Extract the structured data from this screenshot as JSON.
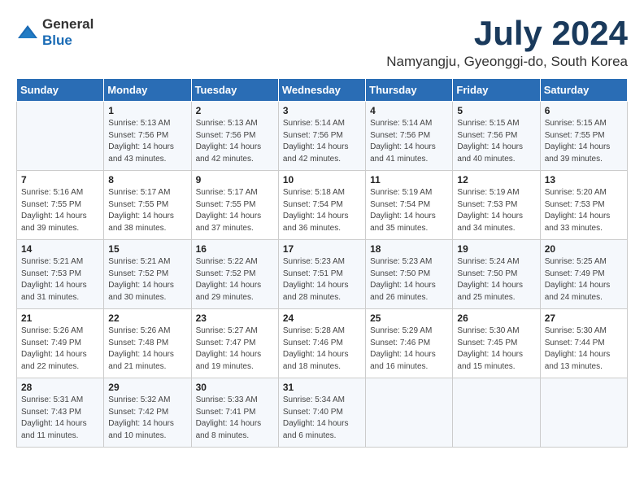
{
  "header": {
    "logo_general": "General",
    "logo_blue": "Blue",
    "month_title": "July 2024",
    "location": "Namyangju, Gyeonggi-do, South Korea"
  },
  "days_of_week": [
    "Sunday",
    "Monday",
    "Tuesday",
    "Wednesday",
    "Thursday",
    "Friday",
    "Saturday"
  ],
  "weeks": [
    [
      {
        "day": "",
        "info": ""
      },
      {
        "day": "1",
        "info": "Sunrise: 5:13 AM\nSunset: 7:56 PM\nDaylight: 14 hours\nand 43 minutes."
      },
      {
        "day": "2",
        "info": "Sunrise: 5:13 AM\nSunset: 7:56 PM\nDaylight: 14 hours\nand 42 minutes."
      },
      {
        "day": "3",
        "info": "Sunrise: 5:14 AM\nSunset: 7:56 PM\nDaylight: 14 hours\nand 42 minutes."
      },
      {
        "day": "4",
        "info": "Sunrise: 5:14 AM\nSunset: 7:56 PM\nDaylight: 14 hours\nand 41 minutes."
      },
      {
        "day": "5",
        "info": "Sunrise: 5:15 AM\nSunset: 7:56 PM\nDaylight: 14 hours\nand 40 minutes."
      },
      {
        "day": "6",
        "info": "Sunrise: 5:15 AM\nSunset: 7:55 PM\nDaylight: 14 hours\nand 39 minutes."
      }
    ],
    [
      {
        "day": "7",
        "info": "Sunrise: 5:16 AM\nSunset: 7:55 PM\nDaylight: 14 hours\nand 39 minutes."
      },
      {
        "day": "8",
        "info": "Sunrise: 5:17 AM\nSunset: 7:55 PM\nDaylight: 14 hours\nand 38 minutes."
      },
      {
        "day": "9",
        "info": "Sunrise: 5:17 AM\nSunset: 7:55 PM\nDaylight: 14 hours\nand 37 minutes."
      },
      {
        "day": "10",
        "info": "Sunrise: 5:18 AM\nSunset: 7:54 PM\nDaylight: 14 hours\nand 36 minutes."
      },
      {
        "day": "11",
        "info": "Sunrise: 5:19 AM\nSunset: 7:54 PM\nDaylight: 14 hours\nand 35 minutes."
      },
      {
        "day": "12",
        "info": "Sunrise: 5:19 AM\nSunset: 7:53 PM\nDaylight: 14 hours\nand 34 minutes."
      },
      {
        "day": "13",
        "info": "Sunrise: 5:20 AM\nSunset: 7:53 PM\nDaylight: 14 hours\nand 33 minutes."
      }
    ],
    [
      {
        "day": "14",
        "info": "Sunrise: 5:21 AM\nSunset: 7:53 PM\nDaylight: 14 hours\nand 31 minutes."
      },
      {
        "day": "15",
        "info": "Sunrise: 5:21 AM\nSunset: 7:52 PM\nDaylight: 14 hours\nand 30 minutes."
      },
      {
        "day": "16",
        "info": "Sunrise: 5:22 AM\nSunset: 7:52 PM\nDaylight: 14 hours\nand 29 minutes."
      },
      {
        "day": "17",
        "info": "Sunrise: 5:23 AM\nSunset: 7:51 PM\nDaylight: 14 hours\nand 28 minutes."
      },
      {
        "day": "18",
        "info": "Sunrise: 5:23 AM\nSunset: 7:50 PM\nDaylight: 14 hours\nand 26 minutes."
      },
      {
        "day": "19",
        "info": "Sunrise: 5:24 AM\nSunset: 7:50 PM\nDaylight: 14 hours\nand 25 minutes."
      },
      {
        "day": "20",
        "info": "Sunrise: 5:25 AM\nSunset: 7:49 PM\nDaylight: 14 hours\nand 24 minutes."
      }
    ],
    [
      {
        "day": "21",
        "info": "Sunrise: 5:26 AM\nSunset: 7:49 PM\nDaylight: 14 hours\nand 22 minutes."
      },
      {
        "day": "22",
        "info": "Sunrise: 5:26 AM\nSunset: 7:48 PM\nDaylight: 14 hours\nand 21 minutes."
      },
      {
        "day": "23",
        "info": "Sunrise: 5:27 AM\nSunset: 7:47 PM\nDaylight: 14 hours\nand 19 minutes."
      },
      {
        "day": "24",
        "info": "Sunrise: 5:28 AM\nSunset: 7:46 PM\nDaylight: 14 hours\nand 18 minutes."
      },
      {
        "day": "25",
        "info": "Sunrise: 5:29 AM\nSunset: 7:46 PM\nDaylight: 14 hours\nand 16 minutes."
      },
      {
        "day": "26",
        "info": "Sunrise: 5:30 AM\nSunset: 7:45 PM\nDaylight: 14 hours\nand 15 minutes."
      },
      {
        "day": "27",
        "info": "Sunrise: 5:30 AM\nSunset: 7:44 PM\nDaylight: 14 hours\nand 13 minutes."
      }
    ],
    [
      {
        "day": "28",
        "info": "Sunrise: 5:31 AM\nSunset: 7:43 PM\nDaylight: 14 hours\nand 11 minutes."
      },
      {
        "day": "29",
        "info": "Sunrise: 5:32 AM\nSunset: 7:42 PM\nDaylight: 14 hours\nand 10 minutes."
      },
      {
        "day": "30",
        "info": "Sunrise: 5:33 AM\nSunset: 7:41 PM\nDaylight: 14 hours\nand 8 minutes."
      },
      {
        "day": "31",
        "info": "Sunrise: 5:34 AM\nSunset: 7:40 PM\nDaylight: 14 hours\nand 6 minutes."
      },
      {
        "day": "",
        "info": ""
      },
      {
        "day": "",
        "info": ""
      },
      {
        "day": "",
        "info": ""
      }
    ]
  ]
}
